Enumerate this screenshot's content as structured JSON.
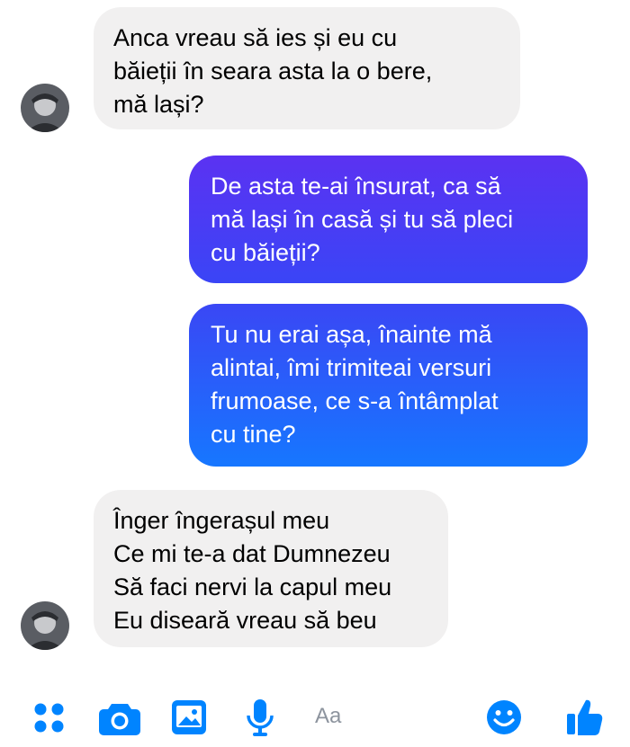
{
  "messages": [
    {
      "direction": "incoming",
      "lines": [
        "Anca vreau să ies și eu cu",
        "băieții în seara asta la o bere,",
        "mă lași?"
      ]
    },
    {
      "direction": "outgoing",
      "lines": [
        "De asta te-ai însurat, ca să",
        "mă lași în casă și tu să pleci",
        "cu băieții?"
      ]
    },
    {
      "direction": "outgoing",
      "lines": [
        "Tu nu erai așa, înainte mă",
        "alintai, îmi trimiteai versuri",
        "frumoase, ce s-a întâmplat",
        "cu tine?"
      ]
    },
    {
      "direction": "incoming",
      "lines": [
        "Înger îngerașul meu",
        "Ce mi te-a dat Dumnezeu",
        "Să faci nervi la capul meu",
        "Eu diseară vreau să beu"
      ]
    }
  ],
  "composer": {
    "placeholder": "Aa",
    "icons": [
      "more-icon",
      "camera-icon",
      "gallery-icon",
      "microphone-icon",
      "emoji-icon",
      "thumbs-up-icon"
    ]
  },
  "colors": {
    "incoming_bubble": "#f1f0f0",
    "outgoing_gradient_top": "#5b32f2",
    "outgoing_gradient_bottom": "#1677ff",
    "accent": "#0084ff",
    "placeholder": "#8d949e"
  }
}
